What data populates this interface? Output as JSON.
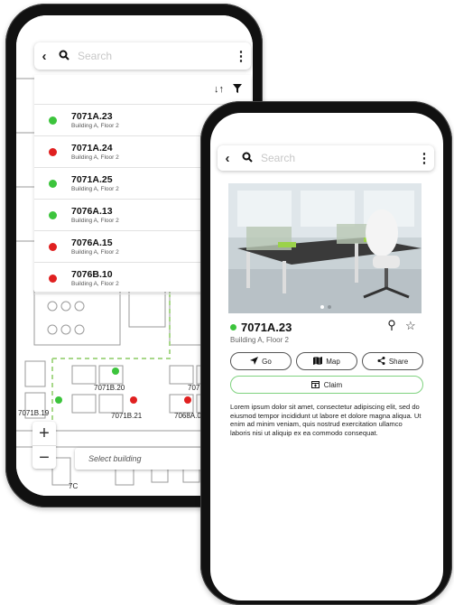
{
  "colors": {
    "available": "#3cc43c",
    "occupied": "#e02020",
    "accent_green": "#7fd27f",
    "path_dash": "#a8d88a",
    "route_orange": "#e8a068"
  },
  "back_screen": {
    "search": {
      "placeholder": "Search",
      "back_icon": "chevron-left-icon",
      "search_icon": "search-icon",
      "more_icon": "more-vert-icon"
    },
    "toolbar": {
      "sort_icon": "sort-icon",
      "filter_icon": "filter-icon"
    },
    "results": [
      {
        "title": "7071A.23",
        "subtitle": "Building A, Floor 2",
        "status": "available"
      },
      {
        "title": "7071A.24",
        "subtitle": "Building A, Floor 2",
        "status": "occupied"
      },
      {
        "title": "7071A.25",
        "subtitle": "Building A, Floor 2",
        "status": "available"
      },
      {
        "title": "7076A.13",
        "subtitle": "Building A, Floor 2",
        "status": "available"
      },
      {
        "title": "7076A.15",
        "subtitle": "Building A, Floor 2",
        "status": "occupied"
      },
      {
        "title": "7076B.10",
        "subtitle": "Building A, Floor 2",
        "status": "occupied"
      }
    ],
    "map_labels": {
      "l1": "7071B.20",
      "l2": "7071",
      "l3": "7071B.19",
      "l4": "7071B.21",
      "l5": "7068A.07",
      "l6": "7C"
    },
    "zoom": {
      "in": "+",
      "out": "−"
    },
    "select_building": {
      "placeholder": "Select building",
      "arrow": "▾"
    }
  },
  "front_screen": {
    "search": {
      "placeholder": "Search",
      "back_icon": "chevron-left-icon",
      "search_icon": "search-icon",
      "more_icon": "more-vert-icon"
    },
    "room": {
      "title": "7071A.23",
      "subtitle": "Building A, Floor 2",
      "status": "available",
      "pin_icon": "location-pin-icon",
      "star_icon": "star-outline-icon"
    },
    "carousel": {
      "dots": 2,
      "active": 0
    },
    "actions": {
      "go": "Go",
      "map": "Map",
      "share": "Share",
      "claim": "Claim"
    },
    "description": "Lorem ipsum dolor sit amet, consectetur adipiscing elit, sed do eiusmod tempor incididunt ut labore et dolore magna aliqua. Ut enim ad minim veniam, quis nostrud exercitation ullamco laboris nisi ut aliquip ex ea commodo consequat."
  }
}
